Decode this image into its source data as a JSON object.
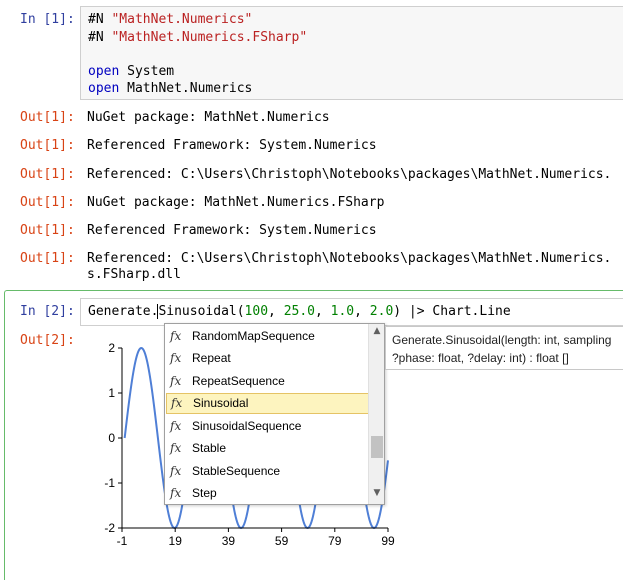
{
  "cell1": {
    "prompt": "In [1]:",
    "code": {
      "line1_dir": "#N",
      "line1_str": "\"MathNet.Numerics\"",
      "line2_dir": "#N",
      "line2_str": "\"MathNet.Numerics.FSharp\"",
      "line4_kw": "open",
      "line4_mod": "System",
      "line5_kw": "open",
      "line5_mod": "MathNet.Numerics"
    },
    "outputs": [
      {
        "prompt": "Out[1]:",
        "text": "NuGet package: MathNet.Numerics"
      },
      {
        "prompt": "Out[1]:",
        "text": "Referenced Framework: System.Numerics"
      },
      {
        "prompt": "Out[1]:",
        "text": "Referenced: C:\\Users\\Christoph\\Notebooks\\packages\\MathNet.Numerics."
      },
      {
        "prompt": "Out[1]:",
        "text": "NuGet package: MathNet.Numerics.FSharp"
      },
      {
        "prompt": "Out[1]:",
        "text": "Referenced Framework: System.Numerics"
      },
      {
        "prompt": "Out[1]:",
        "text": "Referenced: C:\\Users\\Christoph\\Notebooks\\packages\\MathNet.Numerics.",
        "cont": "s.FSharp.dll"
      }
    ]
  },
  "cell2": {
    "prompt": "In [2]:",
    "out_prompt": "Out[2]:",
    "code": {
      "before_cursor": "Generate.",
      "after_cursor": "Sinusoidal(",
      "n1": "100",
      "sep1": ", ",
      "n2": "25.0",
      "sep2": ", ",
      "n3": "1.0",
      "sep3": ", ",
      "n4": "2.0",
      "rest": ") |> Chart.Line"
    }
  },
  "autocomplete": {
    "icon_glyph": "fx",
    "items": [
      {
        "label": "RandomMapSequence"
      },
      {
        "label": "Repeat"
      },
      {
        "label": "RepeatSequence"
      },
      {
        "label": "Sinusoidal",
        "selected": true
      },
      {
        "label": "SinusoidalSequence"
      },
      {
        "label": "Stable"
      },
      {
        "label": "StableSequence"
      },
      {
        "label": "Step"
      }
    ],
    "scroll_up": "▲",
    "scroll_down": "▼"
  },
  "tooltip": {
    "line1": "Generate.Sinusoidal(length: int, sampling",
    "line2": "?phase: float, ?delay: int) : float []"
  },
  "chart_data": {
    "type": "line",
    "title": "",
    "xlabel": "",
    "ylabel": "",
    "xlim": [
      -1,
      99
    ],
    "ylim": [
      -2,
      2
    ],
    "x_ticks": [
      "-1",
      "19",
      "39",
      "59",
      "79",
      "99"
    ],
    "y_ticks": [
      "2",
      "1",
      "0",
      "-1",
      "-2"
    ],
    "series": [
      {
        "color": "#4f7fd6",
        "function": "2*sin(2*pi*(x/25))",
        "x_range": [
          0,
          99
        ]
      }
    ]
  }
}
